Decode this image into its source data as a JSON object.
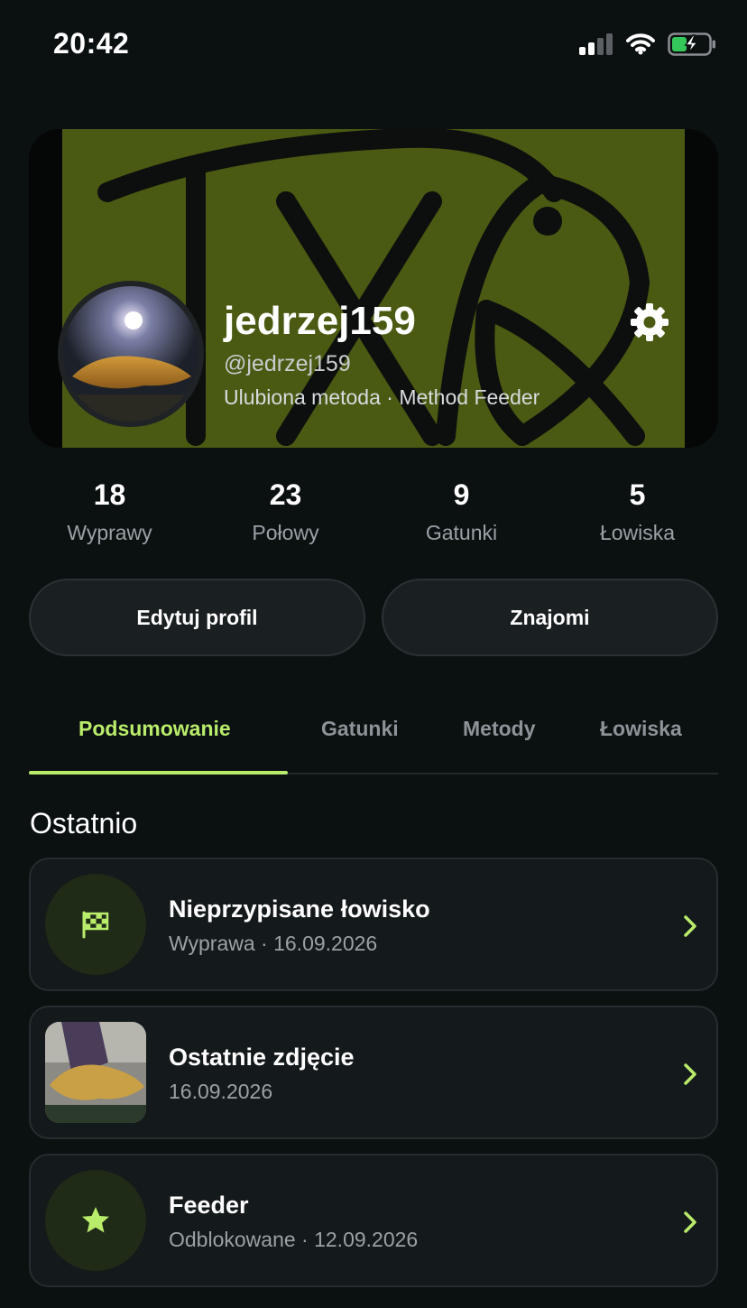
{
  "status_bar": {
    "time": "20:42"
  },
  "profile": {
    "name": "jedrzej159",
    "handle": "@jedrzej159",
    "favorite_method": "Ulubiona metoda · Method Feeder"
  },
  "stats": [
    {
      "value": "18",
      "label": "Wyprawy"
    },
    {
      "value": "23",
      "label": "Połowy"
    },
    {
      "value": "9",
      "label": "Gatunki"
    },
    {
      "value": "5",
      "label": "Łowiska"
    }
  ],
  "actions": {
    "edit_profile": "Edytuj profil",
    "friends": "Znajomi"
  },
  "tabs": [
    {
      "label": "Podsumowanie",
      "active": true
    },
    {
      "label": "Gatunki",
      "active": false
    },
    {
      "label": "Metody",
      "active": false
    },
    {
      "label": "Łowiska",
      "active": false
    }
  ],
  "recent": {
    "title": "Ostatnio",
    "items": [
      {
        "title": "Nieprzypisane łowisko",
        "subtitle": "Wyprawa · 16.09.2026",
        "icon": "checkered-flag-icon"
      },
      {
        "title": "Ostatnie zdjęcie",
        "subtitle": "16.09.2026",
        "icon": "fish-photo"
      },
      {
        "title": "Feeder",
        "subtitle": "Odblokowane · 12.09.2026",
        "icon": "star-icon"
      }
    ]
  },
  "colors": {
    "background": "#0b1011",
    "accent": "#b9ec6a",
    "banner": "#4a5a13",
    "card": "#14191b"
  }
}
